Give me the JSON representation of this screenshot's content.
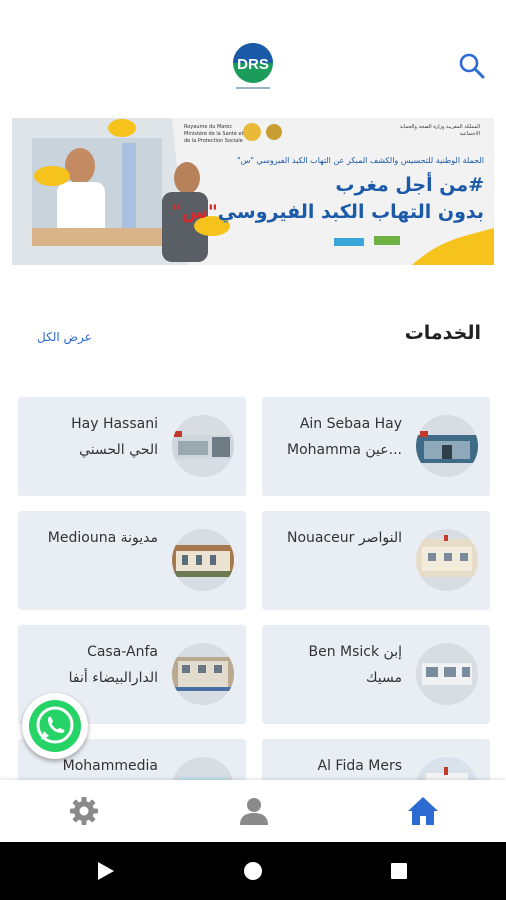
{
  "header": {
    "logo_text": "DRS",
    "search_icon": "search-icon"
  },
  "banner": {
    "ministry_ar": "المملكة المغربية وزارة الصحة والحماية الاجتماعية",
    "ministry_fr": "Royaume du Maroc Ministère de la Santé et de la Protection Sociale",
    "campaign_line": "الحملة الوطنية للتحسيس والكشف المبكر عن التهاب الكبد الفيروسي \"س\"",
    "headline_1": "#من أجل مغرب",
    "headline_2_blue": "بدون التهاب الكبد الفيروسي",
    "headline_2_red": "\"س\""
  },
  "services": {
    "title": "الخدمات",
    "see_all": "عرض الكل",
    "items": [
      {
        "line1": "Ain Sebaa Hay",
        "line2": "Mohamma عين..."
      },
      {
        "line1": "Hay Hassani",
        "line2": "الحي الحسني"
      },
      {
        "line1": "Nouaceur النواصر",
        "line2": ""
      },
      {
        "line1": "Mediouna مديونة",
        "line2": ""
      },
      {
        "line1": "Ben Msick إبن",
        "line2": "مسيك"
      },
      {
        "line1": "Casa-Anfa",
        "line2": "الدارالبيضاء أنفا"
      },
      {
        "line1": "Al Fida Mers",
        "line2": ""
      },
      {
        "line1": "Mohammedia",
        "line2": ""
      }
    ]
  },
  "bottom_nav": {
    "items": [
      "gear-icon",
      "person-icon",
      "home-icon"
    ],
    "active_color": "#2d6bd3",
    "inactive_color": "#8a8a8a"
  },
  "colors": {
    "accent": "#2d6bd3",
    "card_bg": "#e8eef4",
    "whatsapp": "#25d366"
  }
}
